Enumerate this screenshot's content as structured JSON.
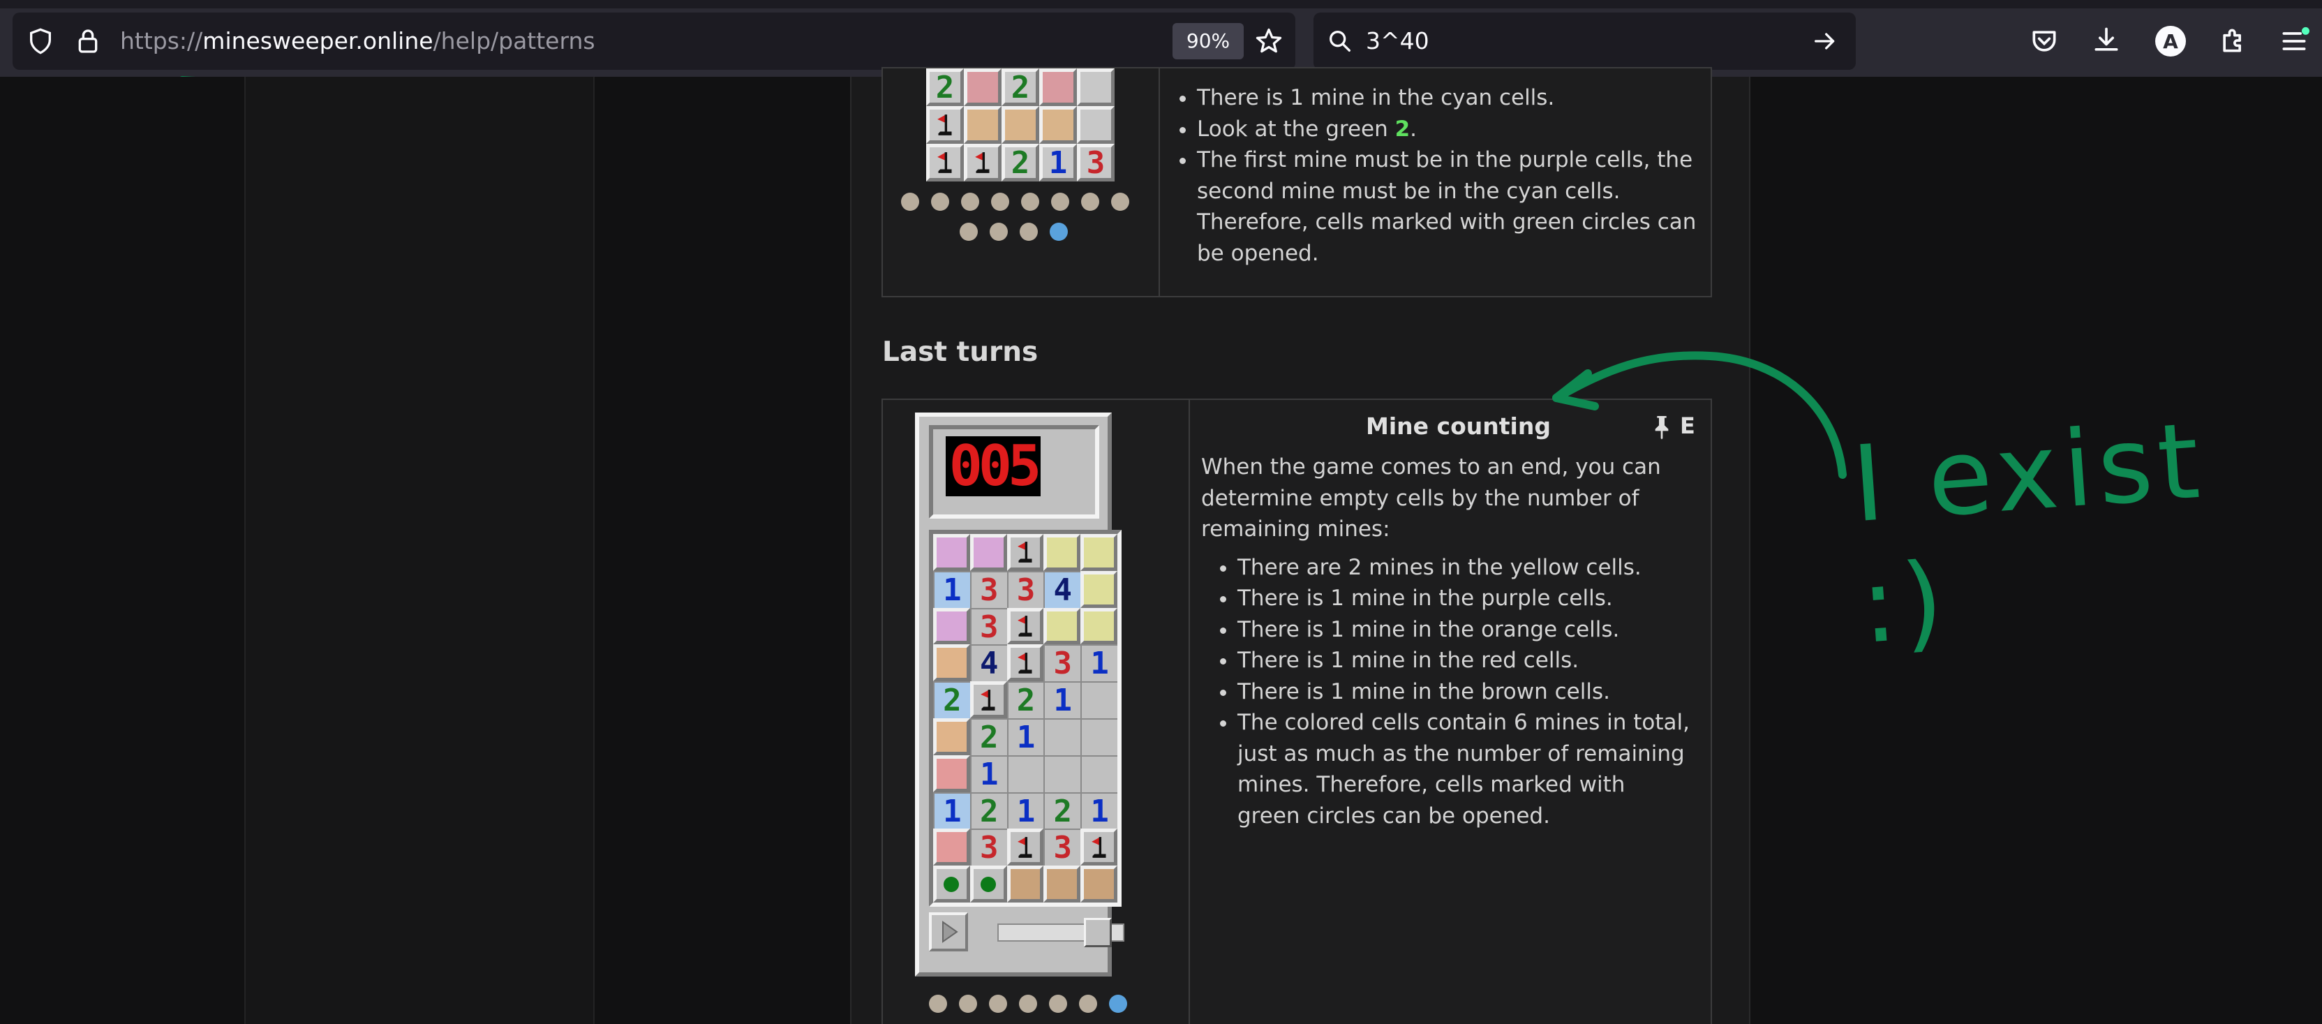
{
  "browser": {
    "url_scheme": "https://",
    "url_host": "minesweeper.online",
    "url_path": "/help/patterns",
    "zoom_label": "90%",
    "search_text": "3^40",
    "profile_initial": "A"
  },
  "top_card": {
    "bullets": [
      "There is 1 mine in the cyan cells.",
      "Look at the green ",
      "The first mine must be in the purple cells, the second mine must be in the cyan cells. Therefore, cells marked with green circles can be opened."
    ],
    "green_number": "2",
    "green_suffix": ".",
    "board_rows": [
      [
        {
          "t": "2",
          "c": "#c8c8c8"
        },
        {
          "t": "",
          "c": "#d99aa0"
        },
        {
          "t": "2",
          "c": "#c8c8c8"
        },
        {
          "t": "",
          "c": "#d99aa0"
        },
        {
          "t": "",
          "c": "#c8c8c8"
        }
      ],
      [
        {
          "t": "F",
          "c": "#c8c8c8"
        },
        {
          "t": "",
          "c": "#d9b48a"
        },
        {
          "t": "",
          "c": "#d9b48a"
        },
        {
          "t": "",
          "c": "#d9b48a"
        },
        {
          "t": "",
          "c": "#c8c8c8"
        }
      ],
      [
        {
          "t": "F",
          "c": "#c8c8c8"
        },
        {
          "t": "F",
          "c": "#c8c8c8"
        },
        {
          "t": "2",
          "c": "#c8c8c8"
        },
        {
          "t": "1",
          "c": "#c8c8c8"
        },
        {
          "t": "3",
          "c": "#c8c8c8"
        }
      ]
    ],
    "dots_row1": 8,
    "dots_row2": 4
  },
  "section": {
    "title": "Last turns"
  },
  "mine_card": {
    "title": "Mine counting",
    "edit_label": "E",
    "intro": "When the game comes to an end, you can determine empty cells by the number of remaining mines:",
    "bullets": [
      "There are 2 mines in the yellow cells.",
      "There is 1 mine in the purple cells.",
      "There is 1 mine in the orange cells.",
      "There is 1 mine in the red cells.",
      "There is 1 mine in the brown cells.",
      "The colored cells contain 6 mines in total, just as much as the number of remaining mines. Therefore, cells marked with green circles can be opened."
    ],
    "counter": "005",
    "board_rows": [
      [
        {
          "t": "",
          "c": "#d8a7d8",
          "k": "r"
        },
        {
          "t": "",
          "c": "#d8a7d8",
          "k": "r"
        },
        {
          "t": "F",
          "c": "#c0c0c0",
          "k": "r"
        },
        {
          "t": "",
          "c": "#dede9a",
          "k": "r"
        },
        {
          "t": "",
          "c": "#dede9a",
          "k": "r"
        }
      ],
      [
        {
          "t": "1",
          "c": "#a9c9ea",
          "k": "f"
        },
        {
          "t": "3",
          "c": "#c0c0c0",
          "k": "f"
        },
        {
          "t": "3",
          "c": "#c0c0c0",
          "k": "f"
        },
        {
          "t": "4",
          "c": "#a9c9ea",
          "k": "f"
        },
        {
          "t": "",
          "c": "#dede9a",
          "k": "r"
        }
      ],
      [
        {
          "t": "",
          "c": "#d8a7d8",
          "k": "r"
        },
        {
          "t": "3",
          "c": "#c0c0c0",
          "k": "f"
        },
        {
          "t": "F",
          "c": "#c0c0c0",
          "k": "r"
        },
        {
          "t": "",
          "c": "#dede9a",
          "k": "r"
        },
        {
          "t": "",
          "c": "#dede9a",
          "k": "r"
        }
      ],
      [
        {
          "t": "",
          "c": "#e0b48a",
          "k": "r"
        },
        {
          "t": "4",
          "c": "#c0c0c0",
          "k": "f"
        },
        {
          "t": "F",
          "c": "#c0c0c0",
          "k": "r"
        },
        {
          "t": "3",
          "c": "#c0c0c0",
          "k": "f"
        },
        {
          "t": "1",
          "c": "#c0c0c0",
          "k": "f"
        }
      ],
      [
        {
          "t": "2",
          "c": "#a9c9ea",
          "k": "f"
        },
        {
          "t": "F",
          "c": "#c0c0c0",
          "k": "r"
        },
        {
          "t": "2",
          "c": "#c0c0c0",
          "k": "f"
        },
        {
          "t": "1",
          "c": "#c0c0c0",
          "k": "f"
        },
        {
          "t": "",
          "c": "#c0c0c0",
          "k": "f"
        }
      ],
      [
        {
          "t": "",
          "c": "#e0b48a",
          "k": "r"
        },
        {
          "t": "2",
          "c": "#c0c0c0",
          "k": "f"
        },
        {
          "t": "1",
          "c": "#c0c0c0",
          "k": "f"
        },
        {
          "t": "",
          "c": "#c0c0c0",
          "k": "f"
        },
        {
          "t": "",
          "c": "#c0c0c0",
          "k": "f"
        }
      ],
      [
        {
          "t": "",
          "c": "#e39a9a",
          "k": "r"
        },
        {
          "t": "1",
          "c": "#c0c0c0",
          "k": "f"
        },
        {
          "t": "",
          "c": "#c0c0c0",
          "k": "f"
        },
        {
          "t": "",
          "c": "#c0c0c0",
          "k": "f"
        },
        {
          "t": "",
          "c": "#c0c0c0",
          "k": "f"
        }
      ],
      [
        {
          "t": "1",
          "c": "#a9c9ea",
          "k": "f"
        },
        {
          "t": "2",
          "c": "#c0c0c0",
          "k": "f"
        },
        {
          "t": "1",
          "c": "#c0c0c0",
          "k": "f"
        },
        {
          "t": "2",
          "c": "#c0c0c0",
          "k": "f"
        },
        {
          "t": "1",
          "c": "#c0c0c0",
          "k": "f"
        }
      ],
      [
        {
          "t": "",
          "c": "#e39a9a",
          "k": "r"
        },
        {
          "t": "3",
          "c": "#c0c0c0",
          "k": "f"
        },
        {
          "t": "F",
          "c": "#c0c0c0",
          "k": "r"
        },
        {
          "t": "3",
          "c": "#c0c0c0",
          "k": "f"
        },
        {
          "t": "F",
          "c": "#c0c0c0",
          "k": "r"
        }
      ],
      [
        {
          "t": "G",
          "c": "#c0c0c0",
          "k": "r"
        },
        {
          "t": "G",
          "c": "#c0c0c0",
          "k": "r"
        },
        {
          "t": "",
          "c": "#c9a27a",
          "k": "r"
        },
        {
          "t": "",
          "c": "#c9a27a",
          "k": "r"
        },
        {
          "t": "",
          "c": "#c9a27a",
          "k": "r"
        }
      ]
    ],
    "dots": 7
  },
  "annotation": {
    "handwritten_text": "I exist :)"
  },
  "colors": {
    "annotation_green": "#0e8a52",
    "dot_active": "#5aa2dd"
  }
}
